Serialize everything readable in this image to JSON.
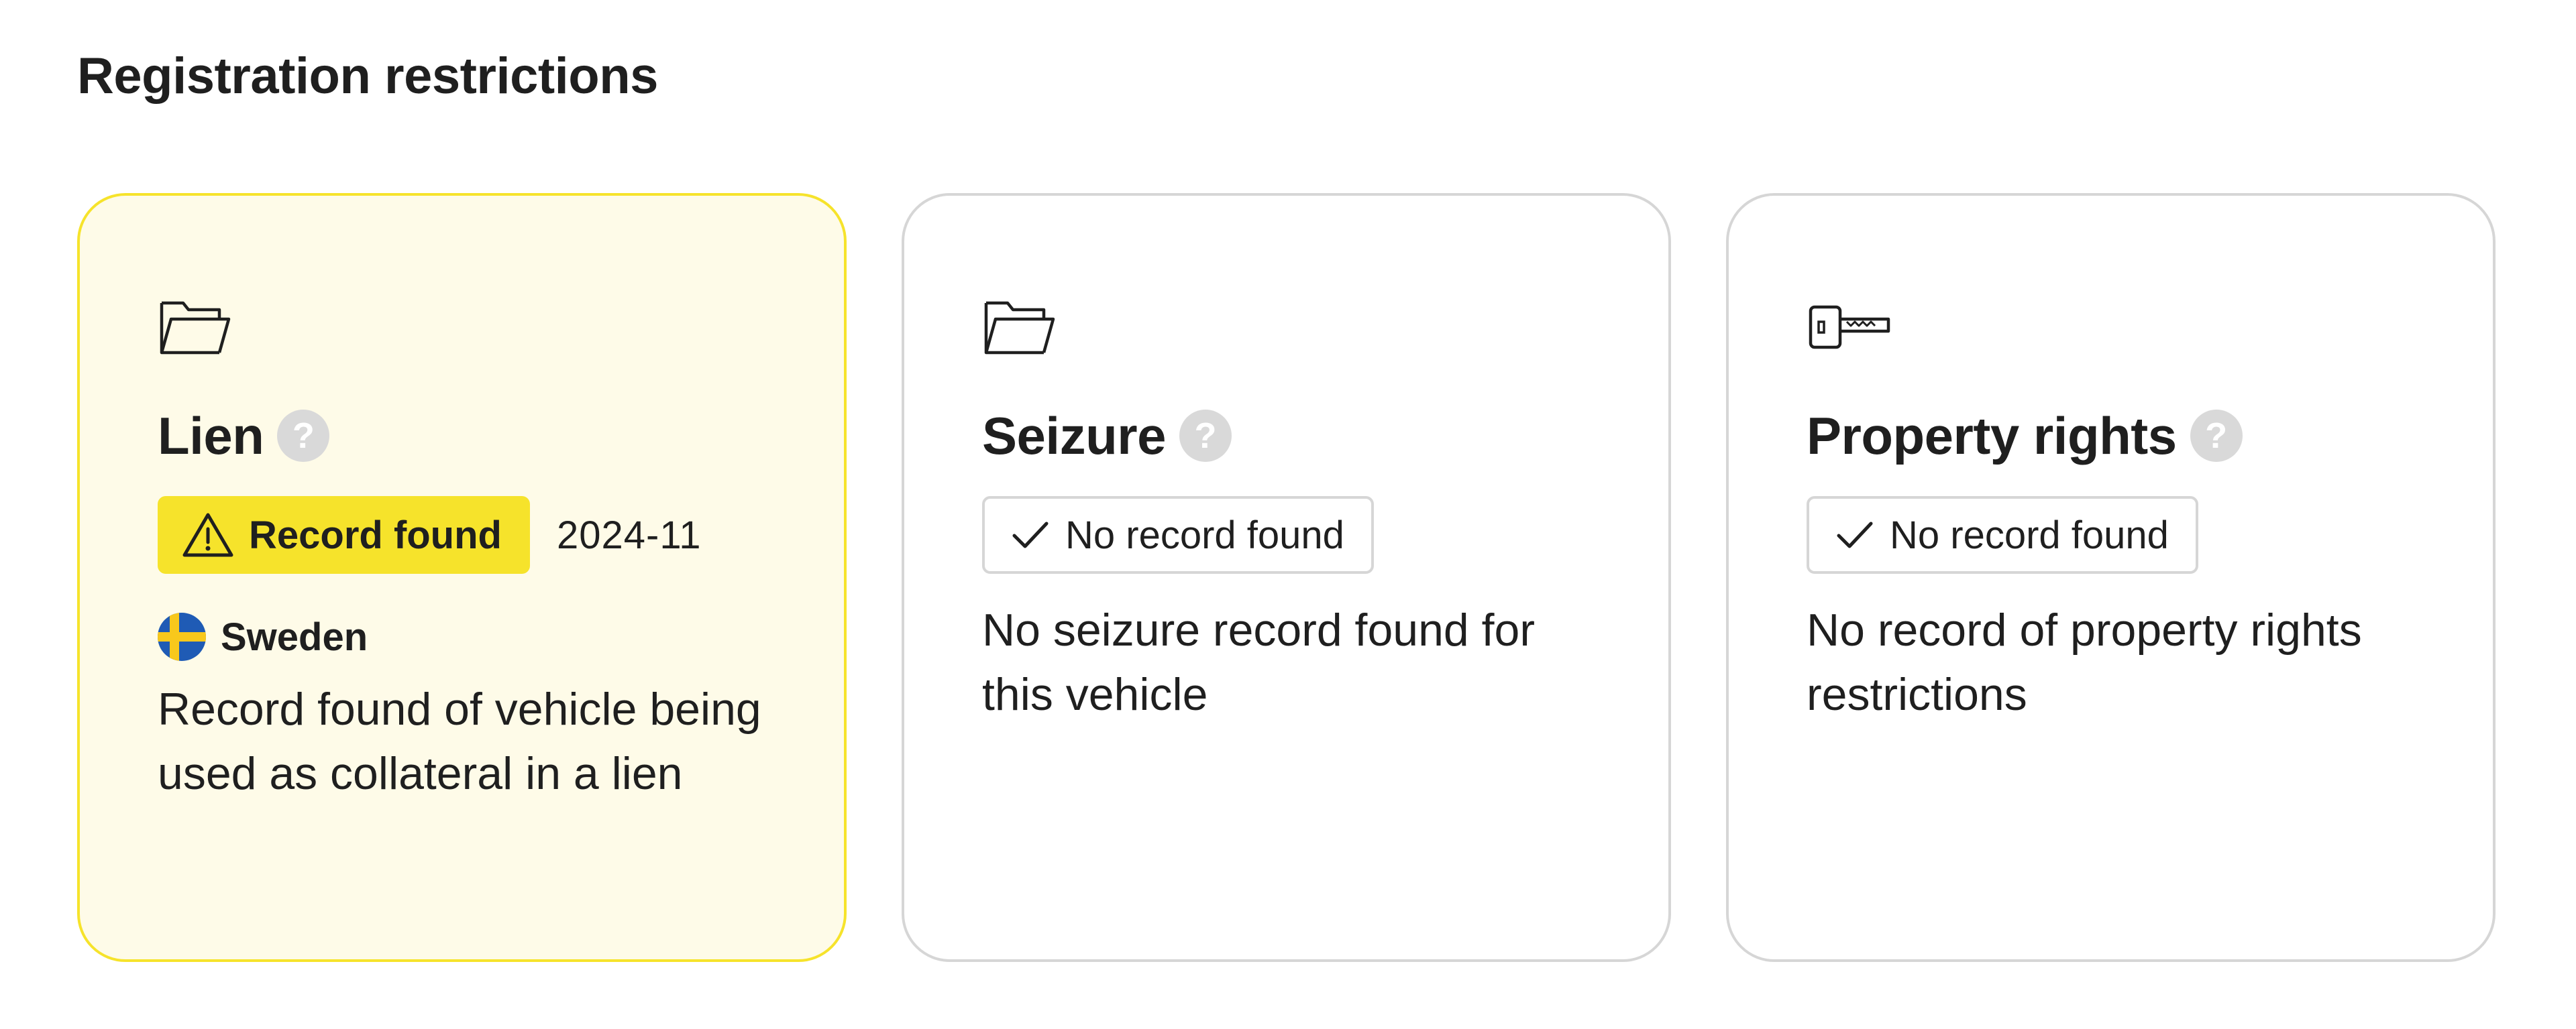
{
  "section": {
    "title": "Registration restrictions"
  },
  "colors": {
    "alert_bg": "#fefbe8",
    "alert_border": "#f6e32b",
    "badge_yellow": "#f6e32b",
    "card_border": "#d6d6d6",
    "help_icon": "#d9d9d9",
    "flag_blue": "#1f5bb5",
    "flag_yellow": "#f8c81c"
  },
  "cards": [
    {
      "icon": "folder-icon",
      "title": "Lien",
      "help": "?",
      "status": "Record found",
      "status_icon": "warning-icon",
      "date": "2024-11",
      "country": "Sweden",
      "description": "Record found of vehicle being used as collateral in a lien"
    },
    {
      "icon": "folder-icon",
      "title": "Seizure",
      "help": "?",
      "status": "No record found",
      "status_icon": "check-icon",
      "description": "No seizure record found for this vehicle"
    },
    {
      "icon": "key-icon",
      "title": "Property rights",
      "help": "?",
      "status": "No record found",
      "status_icon": "check-icon",
      "description": "No record of property rights restrictions"
    }
  ]
}
